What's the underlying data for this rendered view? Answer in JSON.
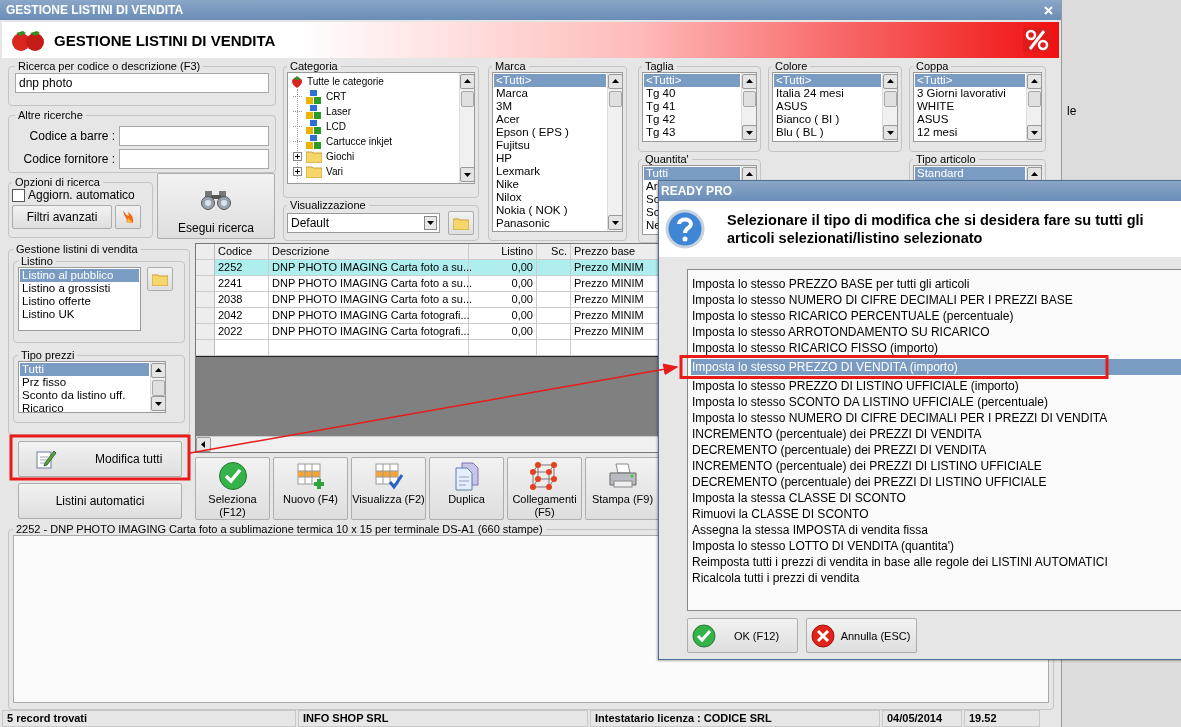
{
  "window": {
    "title": "GESTIONE LISTINI DI VENDITA",
    "header": "GESTIONE LISTINI DI VENDITA"
  },
  "search": {
    "label": "Ricerca per codice o descrizione (F3)",
    "value": "dnp photo"
  },
  "other_searches": {
    "label": "Altre ricerche",
    "fields": [
      {
        "label": "Codice a barre :"
      },
      {
        "label": "Codice fornitore :"
      }
    ]
  },
  "search_options": {
    "label": "Opzioni di ricerca",
    "auto_update": {
      "label": "Aggiorn. automatico",
      "checked": false
    },
    "advanced_button": "Filtri avanzati"
  },
  "run_search_button": "Esegui ricerca",
  "category": {
    "label": "Categoria",
    "tree": [
      {
        "label": "Tutte le categorie",
        "kind": "root",
        "children": [
          {
            "label": "CRT",
            "kind": "category"
          },
          {
            "label": "Laser",
            "kind": "category"
          },
          {
            "label": "LCD",
            "kind": "category"
          },
          {
            "label": "Cartucce inkjet",
            "kind": "category"
          },
          {
            "label": "Giochi",
            "kind": "folder"
          },
          {
            "label": "Vari",
            "kind": "folder"
          }
        ]
      }
    ]
  },
  "view": {
    "label": "Visualizzazione",
    "value": "Default"
  },
  "filters": {
    "marca": {
      "label": "Marca",
      "items": [
        {
          "label": "<Tutti>",
          "selected": true
        },
        {
          "label": "Marca",
          "selected": false
        },
        {
          "label": "3M",
          "selected": false
        },
        {
          "label": "Acer",
          "selected": false
        },
        {
          "label": "Epson ( EPS )",
          "selected": false
        },
        {
          "label": "Fujitsu",
          "selected": false
        },
        {
          "label": "HP",
          "selected": false
        },
        {
          "label": "Lexmark",
          "selected": false
        },
        {
          "label": "Nike",
          "selected": false
        },
        {
          "label": "Nilox",
          "selected": false
        },
        {
          "label": "Nokia ( NOK )",
          "selected": false
        },
        {
          "label": "Panasonic",
          "selected": false
        }
      ]
    },
    "taglia": {
      "label": "Taglia",
      "items": [
        {
          "label": "<Tutti>",
          "selected": true
        },
        {
          "label": "Tg 40",
          "selected": false
        },
        {
          "label": "Tg 41",
          "selected": false
        },
        {
          "label": "Tg 42",
          "selected": false
        },
        {
          "label": "Tg 43",
          "selected": false
        }
      ]
    },
    "colore": {
      "label": "Colore",
      "items": [
        {
          "label": "<Tutti>",
          "selected": true
        },
        {
          "label": "Italia 24 mesi",
          "selected": false
        },
        {
          "label": "ASUS",
          "selected": false
        },
        {
          "label": "Bianco ( BI )",
          "selected": false
        },
        {
          "label": "Blu ( BL )",
          "selected": false
        }
      ]
    },
    "coppa": {
      "label": "Coppa",
      "items": [
        {
          "label": "<Tutti>",
          "selected": true
        },
        {
          "label": "3 Giorni lavorativi",
          "selected": false
        },
        {
          "label": "WHITE",
          "selected": false
        },
        {
          "label": "ASUS",
          "selected": false
        },
        {
          "label": "12 mesi",
          "selected": false
        }
      ]
    },
    "quantita": {
      "label": "Quantita'",
      "items": [
        {
          "label": "Tutti",
          "selected": true
        },
        {
          "label": "Ar",
          "selected": false
        },
        {
          "label": "So",
          "selected": false
        },
        {
          "label": "So",
          "selected": false
        },
        {
          "label": "Ne",
          "selected": false
        }
      ]
    },
    "tipo_articolo": {
      "label": "Tipo articolo",
      "items": [
        {
          "label": "Standard",
          "selected": true
        }
      ]
    }
  },
  "price_lists": {
    "label": "Gestione listini di vendita",
    "listino": {
      "label": "Listino",
      "items": [
        {
          "label": "Listino al pubblico",
          "selected": true
        },
        {
          "label": "Listino a grossisti",
          "selected": false
        },
        {
          "label": "Listino offerte",
          "selected": false
        },
        {
          "label": "Listino UK",
          "selected": false
        }
      ]
    },
    "price_types": {
      "label": "Tipo prezzi",
      "items": [
        {
          "label": "Tutti",
          "selected": true
        },
        {
          "label": "Prz fisso",
          "selected": false
        },
        {
          "label": "Sconto da listino uff.",
          "selected": false
        },
        {
          "label": "Ricarico",
          "selected": false
        }
      ]
    },
    "buttons": [
      "Modifica tutti",
      "Listini automatici"
    ]
  },
  "table": {
    "columns": [
      "Codice",
      "Descrizione",
      "Listino",
      "Sc.",
      "Prezzo base"
    ],
    "rows": [
      {
        "selected": true,
        "cells": [
          "2252",
          "DNP PHOTO IMAGING Carta foto a su...",
          "0,00",
          "",
          "Prezzo MINIM"
        ]
      },
      {
        "selected": false,
        "cells": [
          "2241",
          "DNP PHOTO IMAGING Carta foto a su...",
          "0,00",
          "",
          "Prezzo MINIM"
        ]
      },
      {
        "selected": false,
        "cells": [
          "2038",
          "DNP PHOTO IMAGING Carta foto a su...",
          "0,00",
          "",
          "Prezzo MINIM"
        ]
      },
      {
        "selected": false,
        "cells": [
          "2042",
          "DNP PHOTO IMAGING Carta fotografi...",
          "0,00",
          "",
          "Prezzo MINIM"
        ]
      },
      {
        "selected": false,
        "cells": [
          "2022",
          "DNP PHOTO IMAGING Carta fotografi...",
          "0,00",
          "",
          "Prezzo MINIM"
        ]
      }
    ]
  },
  "toolbar": [
    {
      "label": "Seleziona (F12)",
      "kind": "select"
    },
    {
      "label": "Nuovo (F4)",
      "kind": "new"
    },
    {
      "label": "Visualizza (F2)",
      "kind": "view"
    },
    {
      "label": "Duplica",
      "kind": "duplicate"
    },
    {
      "label": "Collegamenti (F5)",
      "kind": "links"
    },
    {
      "label": "Stampa (F9)",
      "kind": "print"
    }
  ],
  "details": {
    "title": "2252 - DNP PHOTO IMAGING Carta foto a sublimazione termica 10 x 15 per terminale DS-A1 (660 stampe)"
  },
  "status_bar": [
    "5 record trovati",
    "INFO SHOP SRL",
    "Intestatario licenza : CODICE SRL",
    "04/05/2014",
    "19.52"
  ],
  "background_window": {
    "text": "le"
  },
  "dialog": {
    "title": "READY PRO",
    "message": "Selezionare il tipo di modifica che si desidera fare su tutti gli articoli selezionati/listino selezionato",
    "options": [
      {
        "label": "Imposta lo stesso PREZZO BASE per tutti gli articoli",
        "selected": false
      },
      {
        "label": "Imposta lo stesso NUMERO DI CIFRE DECIMALI PER I PREZZI BASE",
        "selected": false
      },
      {
        "label": "Imposta lo stesso RICARICO PERCENTUALE (percentuale)",
        "selected": false
      },
      {
        "label": "Imposta lo stesso ARROTONDAMENTO SU RICARICO",
        "selected": false
      },
      {
        "label": "Imposta lo stesso RICARICO FISSO (importo)",
        "selected": false
      },
      {
        "label": "Imposta lo stesso PREZZO DI VENDITA (importo)",
        "selected": true
      },
      {
        "label": "Imposta lo stesso PREZZO DI LISTINO UFFICIALE (importo)",
        "selected": false
      },
      {
        "label": "Imposta lo stesso SCONTO DA LISTINO UFFICIALE (percentuale)",
        "selected": false
      },
      {
        "label": "Imposta lo stesso NUMERO DI CIFRE DECIMALI PER I PREZZI DI VENDITA",
        "selected": false
      },
      {
        "label": "INCREMENTO (percentuale) dei PREZZI DI VENDITA",
        "selected": false
      },
      {
        "label": "DECREMENTO (percentuale) dei PREZZI DI VENDITA",
        "selected": false
      },
      {
        "label": "INCREMENTO (percentuale) dei PREZZI DI LISTINO UFFICIALE",
        "selected": false
      },
      {
        "label": "DECREMENTO (percentuale) dei PREZZI DI LISTINO UFFICIALE",
        "selected": false
      },
      {
        "label": "Imposta la stessa CLASSE DI SCONTO",
        "selected": false
      },
      {
        "label": "Rimuovi la CLASSE DI SCONTO",
        "selected": false
      },
      {
        "label": "Assegna la stessa IMPOSTA di vendita fissa",
        "selected": false
      },
      {
        "label": "Imposta lo stesso LOTTO DI VENDITA (quantita')",
        "selected": false
      },
      {
        "label": "Reimposta tutti i prezzi di vendita in base alle regole dei LISTINI AUTOMATICI",
        "selected": false
      },
      {
        "label": "Ricalcola tutti i prezzi di vendita",
        "selected": false
      }
    ],
    "buttons": [
      {
        "label": "OK (F12)",
        "kind": "ok"
      },
      {
        "label": "Annulla (ESC)",
        "kind": "cancel"
      }
    ]
  }
}
